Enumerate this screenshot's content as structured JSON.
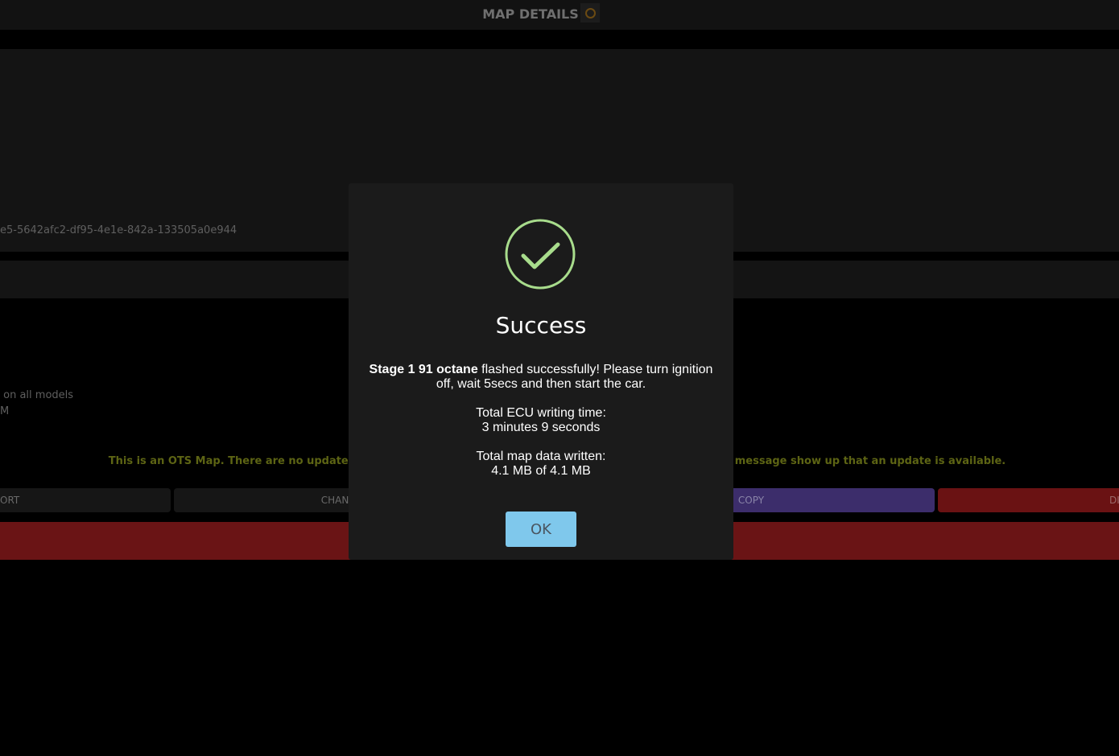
{
  "header": {
    "title": "MAP DETAILS",
    "logo_icon": "brand-ring-icon"
  },
  "background": {
    "map_id_text": "e5-5642afc2-df95-4e1e-842a-133505a0e944",
    "info_line_1": "on all models",
    "info_line_2": "M",
    "ots_notice_left": "This is an OTS Map. There are no update",
    "ots_notice_right": "message show up that an update is available.",
    "buttons": {
      "export_label": "ORT",
      "change_label": "CHAN",
      "copy_label": "COPY",
      "delete_label": "DI"
    }
  },
  "modal": {
    "icon": "check-circle-icon",
    "title": "Success",
    "map_name": "Stage 1 91 octane",
    "message_rest": " flashed successfully! Please turn ignition off, wait 5secs and then start the car.",
    "writing_time_label": "Total ECU writing time:",
    "writing_time_value": "3 minutes 9 seconds",
    "data_written_label": "Total map data written:",
    "data_written_value": "4.1 MB of 4.1 MB",
    "ok_label": "OK"
  },
  "colors": {
    "success_green": "#a8dc8c",
    "ok_button": "#7fc8ec",
    "copy_button": "#3c2d6b",
    "danger_red": "#6a1415",
    "notice_yellow": "#5d6414"
  }
}
